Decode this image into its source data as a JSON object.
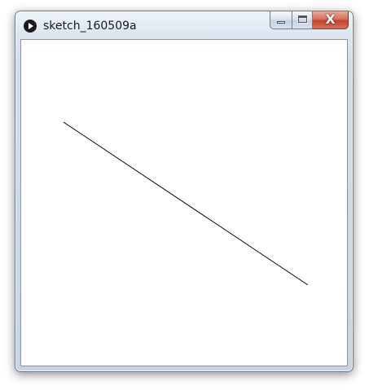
{
  "window": {
    "title": "sketch_160509a",
    "icon": "processing-play-icon"
  },
  "title_bar_buttons": {
    "minimize_icon": "minimize-icon",
    "maximize_icon": "maximize-icon",
    "close_icon": "close-icon",
    "close_glyph": "X"
  },
  "colors": {
    "close_button": "#c4422a",
    "line_stroke": "#000000",
    "canvas_background": "#ffffff"
  }
}
